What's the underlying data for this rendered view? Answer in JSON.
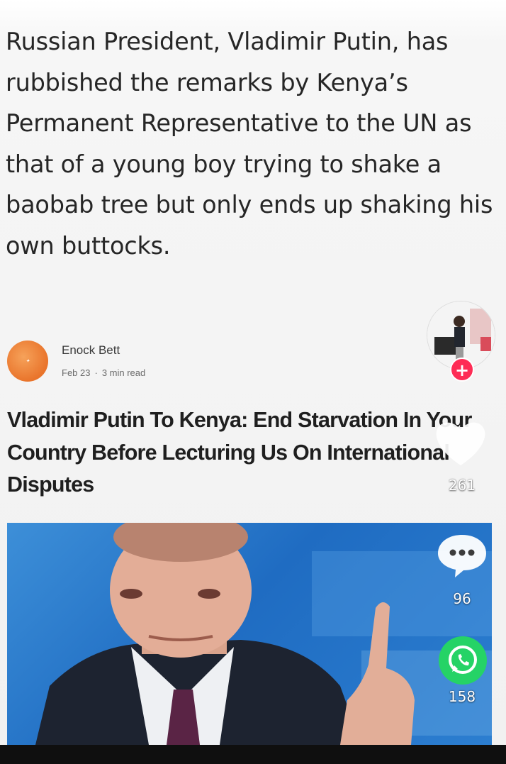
{
  "post": {
    "quote_text": "Russian President, Vladimir Putin, has rubbished the remarks by Kenya’s Permanent Representative to the UN as that of a young boy trying to shake a baobab tree but only ends up shaking his own buttocks.",
    "author": {
      "name": "Enock Bett",
      "date": "Feb 23",
      "separator": "·",
      "read_time": "3 min read",
      "logo_icon": "publication-logo-icon"
    },
    "headline": "Vladimir Putin To Kenya: End Starvation In Your Country Before Lecturing Us On International Disputes",
    "photo_icon": "putin-photo"
  },
  "actions": {
    "follow_label": "+",
    "likes": "261",
    "comments": "96",
    "shares": "158",
    "icons": {
      "like": "heart-icon",
      "comment": "comment-bubble-icon",
      "share": "whatsapp-icon",
      "avatar": "creator-avatar"
    }
  },
  "colors": {
    "follow_button": "#fe2c55",
    "share_button": "#25d366",
    "text_primary": "#262626"
  }
}
